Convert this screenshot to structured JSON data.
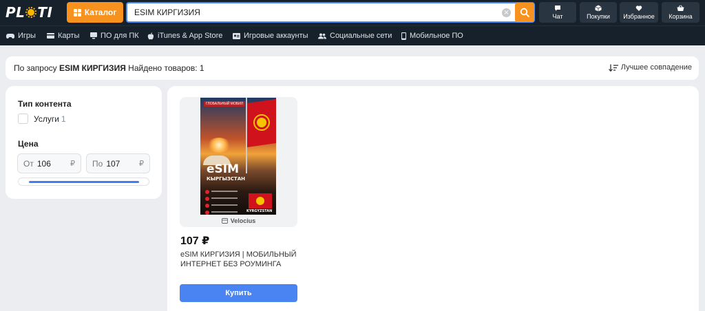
{
  "header": {
    "logo_left": "PL",
    "logo_right": "TI",
    "catalog_label": "Каталог",
    "search": {
      "value": "ESIM КИРГИЗИЯ",
      "placeholder": ""
    },
    "buttons": [
      {
        "label": "Чат",
        "icon": "chat-icon"
      },
      {
        "label": "Покупки",
        "icon": "purchases-icon"
      },
      {
        "label": "Избранное",
        "icon": "heart-icon"
      },
      {
        "label": "Корзина",
        "icon": "cart-icon"
      }
    ],
    "accent_color": "#f7921e",
    "bg_color": "#17212b"
  },
  "nav": {
    "items": [
      {
        "label": "Игры",
        "icon": "gamepad-icon"
      },
      {
        "label": "Карты",
        "icon": "card-icon"
      },
      {
        "label": "ПО для ПК",
        "icon": "software-icon"
      },
      {
        "label": "iTunes & App Store",
        "icon": "apple-icon"
      },
      {
        "label": "Игровые аккаунты",
        "icon": "account-icon"
      },
      {
        "label": "Социальные сети",
        "icon": "people-icon"
      },
      {
        "label": "Мобильное ПО",
        "icon": "mobile-icon"
      }
    ]
  },
  "summary": {
    "prefix": "По запросу",
    "query": "ESIM КИРГИЗИЯ",
    "found": "Найдено товаров: 1",
    "sort_label": "Лучшее совпадение"
  },
  "filters": {
    "content_type_title": "Тип контента",
    "content_types": [
      {
        "label": "Услуги",
        "count": "1",
        "checked": false
      }
    ],
    "price_title": "Цена",
    "price_from_label": "От",
    "price_from": "106",
    "price_to_label": "По",
    "price_to": "107",
    "currency": "₽"
  },
  "products": [
    {
      "poster": {
        "brand": "ГЛОБАЛЬНЫЙ МОБИЛ",
        "headline": "eSIM",
        "country": "КЫРГЫЗСТАН",
        "flag_label": "KYRGYZSTAN"
      },
      "seller": "Velocius",
      "price": "107 ₽",
      "title": "eSIM КИРГИЗИЯ | МОБИЛЬНЫЙ ИНТЕРНЕТ БЕЗ РОУМИНГА",
      "buy_label": "Купить"
    }
  ]
}
